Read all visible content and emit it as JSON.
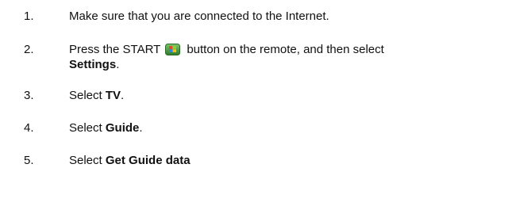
{
  "steps": [
    {
      "number": "1.",
      "text": "Make sure that you are connected to the Internet."
    },
    {
      "number": "2.",
      "text_before": "Press the START",
      "icon": "windows-start-icon",
      "text_after": "button on the remote, and then select",
      "bold": "Settings",
      "text_end": "."
    },
    {
      "number": "3.",
      "text": "Select",
      "bold": "TV",
      "text_end": "."
    },
    {
      "number": "4.",
      "text": "Select",
      "bold": "Guide",
      "text_end": "."
    },
    {
      "number": "5.",
      "text": "Select",
      "bold": "Get Guide data"
    }
  ]
}
